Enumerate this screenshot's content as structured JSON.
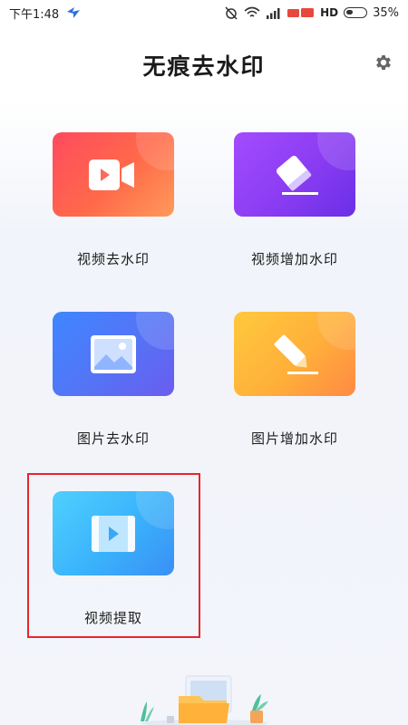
{
  "status_bar": {
    "time": "下午1:48",
    "network": "HD",
    "battery": "35%"
  },
  "header": {
    "title": "无痕去水印",
    "settings_icon": "gear-icon"
  },
  "tiles": [
    {
      "label": "视频去水印",
      "icon": "video-camera-icon",
      "color": "#ff5a52"
    },
    {
      "label": "视频增加水印",
      "icon": "eraser-icon",
      "color": "#8f3ff3"
    },
    {
      "label": "图片去水印",
      "icon": "image-icon",
      "color": "#4a7df8"
    },
    {
      "label": "图片增加水印",
      "icon": "pencil-icon",
      "color": "#ffae3c"
    },
    {
      "label": "视频提取",
      "icon": "video-frame-icon",
      "color": "#3fb6fb"
    }
  ],
  "colors": {
    "selection_border": "#e8262b",
    "title_text": "#1a1a1a"
  }
}
